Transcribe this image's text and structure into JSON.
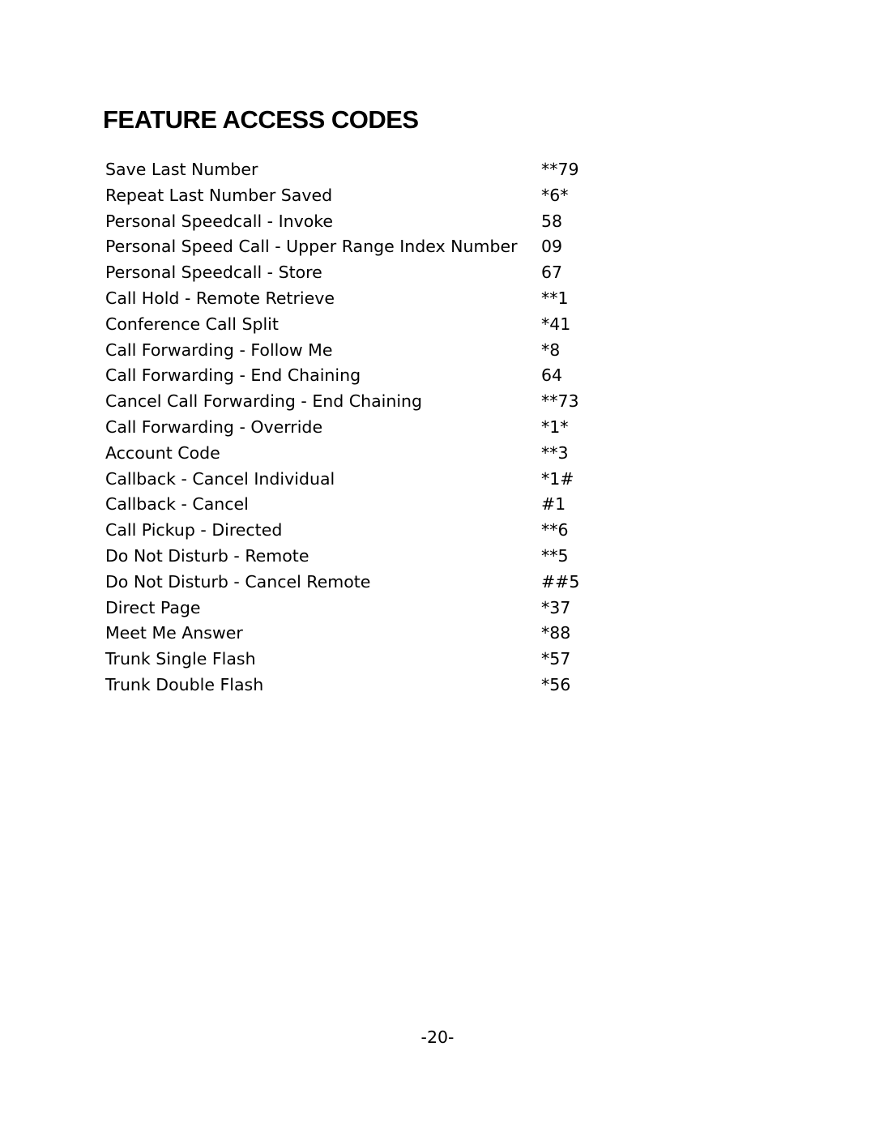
{
  "page": {
    "title": "FEATURE ACCESS CODES",
    "page_number": "-20-"
  },
  "codes": [
    {
      "feature": "Save Last Number",
      "code": "**79"
    },
    {
      "feature": "Repeat Last Number Saved",
      "code": "*6*"
    },
    {
      "feature": "Personal Speedcall - Invoke",
      "code": "58"
    },
    {
      "feature": "Personal Speed Call - Upper Range Index Number",
      "code": "09"
    },
    {
      "feature": "Personal Speedcall - Store",
      "code": "67"
    },
    {
      "feature": "Call Hold - Remote Retrieve",
      "code": "**1"
    },
    {
      "feature": "Conference Call Split",
      "code": "*41"
    },
    {
      "feature": "Call Forwarding - Follow Me",
      "code": "*8"
    },
    {
      "feature": "Call Forwarding - End Chaining",
      "code": "64"
    },
    {
      "feature": "Cancel Call Forwarding - End Chaining",
      "code": "**73"
    },
    {
      "feature": "Call Forwarding - Override",
      "code": "*1*"
    },
    {
      "feature": "Account Code",
      "code": "**3"
    },
    {
      "feature": "Callback - Cancel Individual",
      "code": "*1#"
    },
    {
      "feature": "Callback - Cancel",
      "code": "#1"
    },
    {
      "feature": "Call Pickup - Directed",
      "code": "**6"
    },
    {
      "feature": "Do Not Disturb - Remote",
      "code": "**5"
    },
    {
      "feature": "Do Not Disturb - Cancel Remote",
      "code": "##5"
    },
    {
      "feature": "Direct Page",
      "code": "*37"
    },
    {
      "feature": "Meet Me Answer",
      "code": "*88"
    },
    {
      "feature": "Trunk Single Flash",
      "code": "*57"
    },
    {
      "feature": "Trunk Double Flash",
      "code": "*56"
    }
  ]
}
